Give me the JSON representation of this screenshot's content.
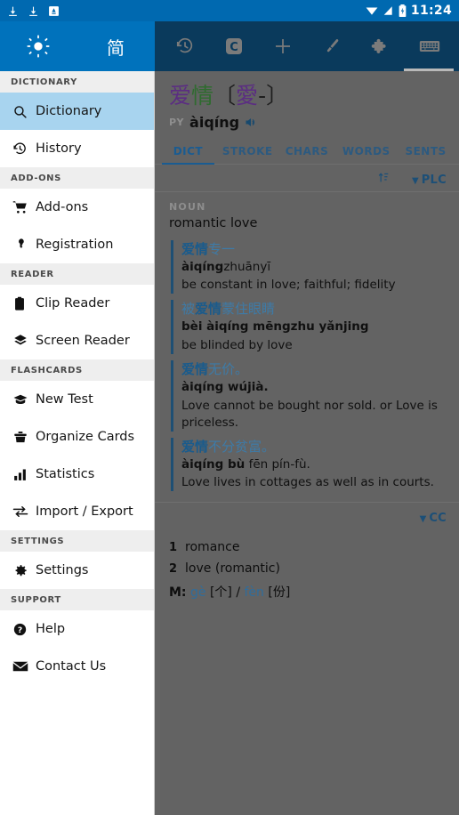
{
  "statusbar": {
    "icons": [
      "download-icon",
      "download-icon",
      "app-notification-icon"
    ],
    "right_icons": [
      "wifi-icon",
      "signal-icon",
      "battery-charging-icon"
    ],
    "time": "11:24"
  },
  "appbar": {
    "brightness_icon": "sun-icon",
    "script_toggle_label": "简",
    "tools": [
      {
        "name": "history-icon",
        "label": "History"
      },
      {
        "name": "clipboard-c-icon",
        "label": "C"
      },
      {
        "name": "plus-icon",
        "label": "Add"
      },
      {
        "name": "brush-icon",
        "label": "Draw"
      },
      {
        "name": "puzzle-icon",
        "label": "Add-ons"
      },
      {
        "name": "keyboard-icon",
        "label": "Keyboard"
      }
    ]
  },
  "sidebar": {
    "sections": [
      {
        "header": "DICTIONARY",
        "items": [
          {
            "label": "Dictionary",
            "icon": "search-icon",
            "active": true
          },
          {
            "label": "History",
            "icon": "history-icon",
            "active": false
          }
        ]
      },
      {
        "header": "ADD-ONS",
        "items": [
          {
            "label": "Add-ons",
            "icon": "cart-icon",
            "active": false
          },
          {
            "label": "Registration",
            "icon": "key-icon",
            "active": false
          }
        ]
      },
      {
        "header": "READER",
        "items": [
          {
            "label": "Clip Reader",
            "icon": "clipboard-icon",
            "active": false
          },
          {
            "label": "Screen Reader",
            "icon": "layers-icon",
            "active": false
          }
        ]
      },
      {
        "header": "FLASHCARDS",
        "items": [
          {
            "label": "New Test",
            "icon": "graduation-cap-icon",
            "active": false
          },
          {
            "label": "Organize Cards",
            "icon": "card-box-icon",
            "active": false
          },
          {
            "label": "Statistics",
            "icon": "bar-chart-icon",
            "active": false
          },
          {
            "label": "Import / Export",
            "icon": "transfer-icon",
            "active": false
          }
        ]
      },
      {
        "header": "SETTINGS",
        "items": [
          {
            "label": "Settings",
            "icon": "gear-icon",
            "active": false
          }
        ]
      },
      {
        "header": "SUPPORT",
        "items": [
          {
            "label": "Help",
            "icon": "question-circle-icon",
            "active": false
          },
          {
            "label": "Contact Us",
            "icon": "envelope-icon",
            "active": false
          }
        ]
      }
    ]
  },
  "entry": {
    "simplified_a": "爱",
    "simplified_b": "情",
    "traditional_open": "〔",
    "traditional_char": "愛",
    "traditional_dash": "-",
    "traditional_close": "〕",
    "pinyin_tag": "PY",
    "pinyin": "àiqíng",
    "audio_icon": "speaker-icon",
    "tabs": [
      {
        "label": "DICT",
        "selected": true
      },
      {
        "label": "STROKE",
        "selected": false
      },
      {
        "label": "CHARS",
        "selected": false
      },
      {
        "label": "WORDS",
        "selected": false
      },
      {
        "label": "SENTS",
        "selected": false
      }
    ]
  },
  "plc": {
    "source_label": "PLC",
    "sort_icon": "sort-icon",
    "caret_icon": "caret-down-icon",
    "pos": "NOUN",
    "sense": "romantic love",
    "examples": [
      {
        "hanzi_bold": "爱情",
        "hanzi_rest": "专一",
        "pinyin_bold": "àiqíng",
        "pinyin_rest": "zhuānyī",
        "pinyin_prefix_bold": "",
        "english": "be constant in love; faithful; fidelity"
      },
      {
        "hanzi_prefix": "被",
        "hanzi_bold": "爱情",
        "hanzi_rest": "蒙住眼睛",
        "pinyin_prefix_bold": "bèi ",
        "pinyin_bold": "àiqíng",
        "pinyin_rest": " mēngzhu yǎnjing",
        "english": "be blinded by love"
      },
      {
        "hanzi_bold": "爱情",
        "hanzi_rest": "无价。",
        "pinyin_bold": "àiqíng",
        "pinyin_rest": " wújià.",
        "pinyin_prefix_bold": "",
        "english": "Love cannot be bought nor sold. or Love is priceless."
      },
      {
        "hanzi_bold": "爱情",
        "hanzi_rest": "不分贫富。",
        "pinyin_bold": "àiqíng bù",
        "pinyin_rest": " fēn pín-fù.",
        "pinyin_prefix_bold": "",
        "english": "Love lives in cottages as well as in courts."
      }
    ]
  },
  "cc": {
    "source_label": "CC",
    "caret_icon": "caret-down-icon",
    "senses": [
      {
        "num": "1",
        "text": "romance"
      },
      {
        "num": "2",
        "text": "love (romantic)"
      }
    ],
    "measure_tag": "M:",
    "measure_py1": "gè",
    "measure_hz1": "[个]",
    "measure_sep": "/",
    "measure_py2": "fèn",
    "measure_hz2": "[份]"
  },
  "colors": {
    "status_bar": "#0069b0",
    "app_bar_left": "#0072bc",
    "app_bar_right": "#0a3a5c",
    "sidebar_bg": "#ffffff",
    "sidebar_active": "#a8d4ef",
    "content_dim": "#636363",
    "accent_blue": "#1a5c92",
    "simplified_purple": "#5b2d82",
    "simplified_green": "#2f6b2f"
  }
}
